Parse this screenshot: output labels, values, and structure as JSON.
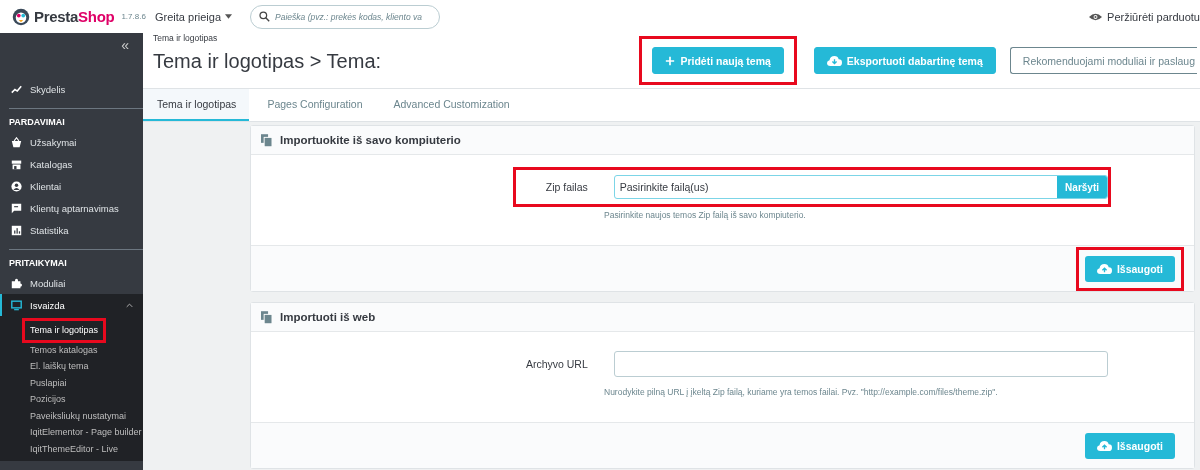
{
  "header": {
    "logo": {
      "first": "Presta",
      "second": "Shop"
    },
    "version": "1.7.8.6",
    "quick_access": "Greita prieiga",
    "search": {
      "placeholder": "Paieška (pvz.: prekės kodas, kliento va"
    },
    "view_shop": "Peržiūrėti parduotu"
  },
  "sidebar": {
    "collapse": "«",
    "sections": [
      {
        "items": [
          {
            "label": "Skydelis",
            "selected": false
          }
        ]
      },
      {
        "title": "PARDAVIMAI",
        "items": [
          {
            "label": "Užsakymai",
            "selected": false
          },
          {
            "label": "Katalogas",
            "selected": false
          },
          {
            "label": "Klientai",
            "selected": false
          },
          {
            "label": "Klientų aptarnavimas",
            "selected": false
          },
          {
            "label": "Statistika",
            "selected": false
          }
        ]
      },
      {
        "title": "PRITAIKYMAI",
        "items": [
          {
            "label": "Moduliai",
            "selected": false
          },
          {
            "label": "Isvaizda",
            "selected": true,
            "expanded": true,
            "children": [
              {
                "label": "Tema ir logotipas",
                "selected": true,
                "highlighted": true
              },
              {
                "label": "Temos katalogas",
                "selected": false,
                "highlighted": false
              },
              {
                "label": "El. laiškų tema",
                "selected": false,
                "highlighted": false
              },
              {
                "label": "Puslapiai",
                "selected": false,
                "highlighted": false
              },
              {
                "label": "Pozicijos",
                "selected": false,
                "highlighted": false
              },
              {
                "label": "Paveiksliukų nustatymai",
                "selected": false,
                "highlighted": false
              },
              {
                "label": "IqitElementor - Page builder",
                "selected": false,
                "highlighted": false
              },
              {
                "label": "IqitThemeEditor - Live",
                "selected": false,
                "highlighted": false
              }
            ]
          }
        ]
      }
    ]
  },
  "breadcrumb": "Tema ir logotipas",
  "title": "Tema ir logotipas > Tema:",
  "actions": [
    {
      "label": "Pridėti naują temą",
      "kind": "add",
      "highlighted": true
    },
    {
      "label": "Eksportuoti dabartinę temą",
      "kind": "export",
      "highlighted": false
    },
    {
      "label": "Rekomenduojami moduliai ir paslaug",
      "kind": "outline",
      "highlighted": false
    }
  ],
  "tabs": [
    {
      "label": "Tema ir logotipas",
      "selected": true
    },
    {
      "label": "Pages Configuration",
      "selected": false
    },
    {
      "label": "Advanced Customization",
      "selected": false
    }
  ],
  "panels": [
    {
      "title": "Importuokite iš savo kompiuterio",
      "field": {
        "label": "Zip failas",
        "kind": "file",
        "value": "Pasirinkite failą(us)",
        "button": "Naršyti",
        "highlighted": true
      },
      "help": "Pasirinkite naujos temos Zip failą iš savo kompiuterio.",
      "save": {
        "label": "Išsaugoti",
        "highlighted": true
      }
    },
    {
      "title": "Importuoti iš web",
      "field": {
        "label": "Archyvo URL",
        "kind": "text",
        "highlighted": false
      },
      "help": "Nurodykite pilną URL į įkeltą Zip failą, kuriame yra temos failai. Pvz. \"http://example.com/files/theme.zip\".",
      "save": {
        "label": "Išsaugoti",
        "highlighted": false
      }
    }
  ]
}
